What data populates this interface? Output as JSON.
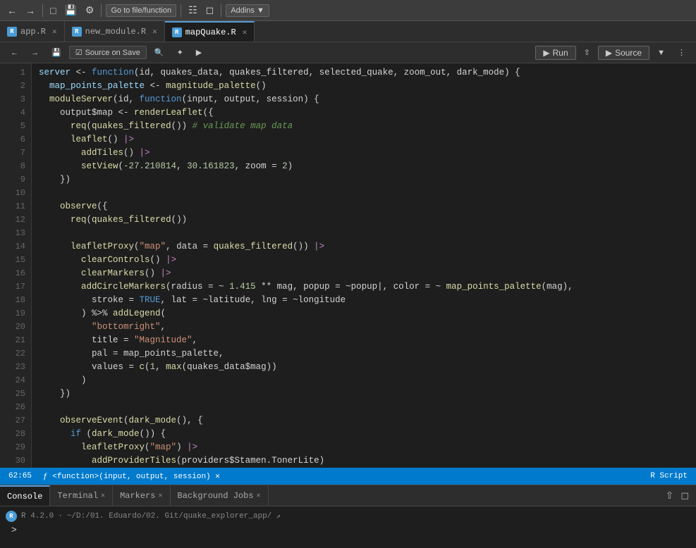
{
  "topToolbar": {
    "goToFileBtn": "Go to file/function",
    "addinsBtn": "Addins ▼"
  },
  "tabs": [
    {
      "label": "app.R",
      "active": false,
      "icon": "R"
    },
    {
      "label": "new_module.R",
      "active": false,
      "icon": "R"
    },
    {
      "label": "mapQuake.R",
      "active": true,
      "icon": "R"
    }
  ],
  "editorToolbar": {
    "sourceOnSave": "Source on Save",
    "runBtn": "Run",
    "sourceBtn": "Source",
    "sourceDropdown": "▼"
  },
  "code": [
    {
      "num": 1,
      "text": "server <- function(id, quakes_data, quakes_filtered, selected_quake, zoom_out, dark_mode) {"
    },
    {
      "num": 2,
      "text": "  map_points_palette <- magnitude_palette()"
    },
    {
      "num": 3,
      "text": "  moduleServer(id, function(input, output, session) {"
    },
    {
      "num": 4,
      "text": "    output$map <- renderLeaflet({"
    },
    {
      "num": 5,
      "text": "      req(quakes_filtered()) # validate map data"
    },
    {
      "num": 6,
      "text": "      leaflet() |>"
    },
    {
      "num": 7,
      "text": "        addTiles() |>"
    },
    {
      "num": 8,
      "text": "        setView(-27.210814, 30.161823, zoom = 2)"
    },
    {
      "num": 9,
      "text": "    })"
    },
    {
      "num": 10,
      "text": ""
    },
    {
      "num": 11,
      "text": "    observe({"
    },
    {
      "num": 12,
      "text": "      req(quakes_filtered())"
    },
    {
      "num": 13,
      "text": ""
    },
    {
      "num": 14,
      "text": "      leafletProxy(\"map\", data = quakes_filtered()) |>"
    },
    {
      "num": 15,
      "text": "        clearControls() |>"
    },
    {
      "num": 16,
      "text": "        clearMarkers() |>"
    },
    {
      "num": 17,
      "text": "        addCircleMarkers(radius = ~ 1.415 ** mag, popup = ~popup|, color = ~ map_points_palette(mag),"
    },
    {
      "num": 18,
      "text": "          stroke = TRUE, lat = ~latitude, lng = ~longitude"
    },
    {
      "num": 19,
      "text": "        ) %>% addLegend("
    },
    {
      "num": 20,
      "text": "          \"bottomright\","
    },
    {
      "num": 21,
      "text": "          title = \"Magnitude\","
    },
    {
      "num": 22,
      "text": "          pal = map_points_palette,"
    },
    {
      "num": 23,
      "text": "          values = c(1, max(quakes_data$mag))"
    },
    {
      "num": 24,
      "text": "        )"
    },
    {
      "num": 25,
      "text": "    })"
    },
    {
      "num": 26,
      "text": ""
    },
    {
      "num": 27,
      "text": "    observeEvent(dark_mode(), {"
    },
    {
      "num": 28,
      "text": "      if (dark_mode()) {"
    },
    {
      "num": 29,
      "text": "        leafletProxy(\"map\") |>"
    },
    {
      "num": 30,
      "text": "          addProviderTiles(providers$Stamen.TonerLite)"
    }
  ],
  "statusBar": {
    "position": "62:65",
    "context": "ƒ <function>(input, output, session) ✕",
    "scriptType": "R Script"
  },
  "consoleTabs": [
    {
      "label": "Console",
      "active": true
    },
    {
      "label": "Terminal",
      "active": false
    },
    {
      "label": "Markers",
      "active": false
    },
    {
      "label": "Background Jobs",
      "active": false
    }
  ],
  "console": {
    "rVersion": "R 4.2.0",
    "path": "~/D:/01. Eduardo/02. Git/quake_explorer_app/",
    "prompt": ">"
  }
}
